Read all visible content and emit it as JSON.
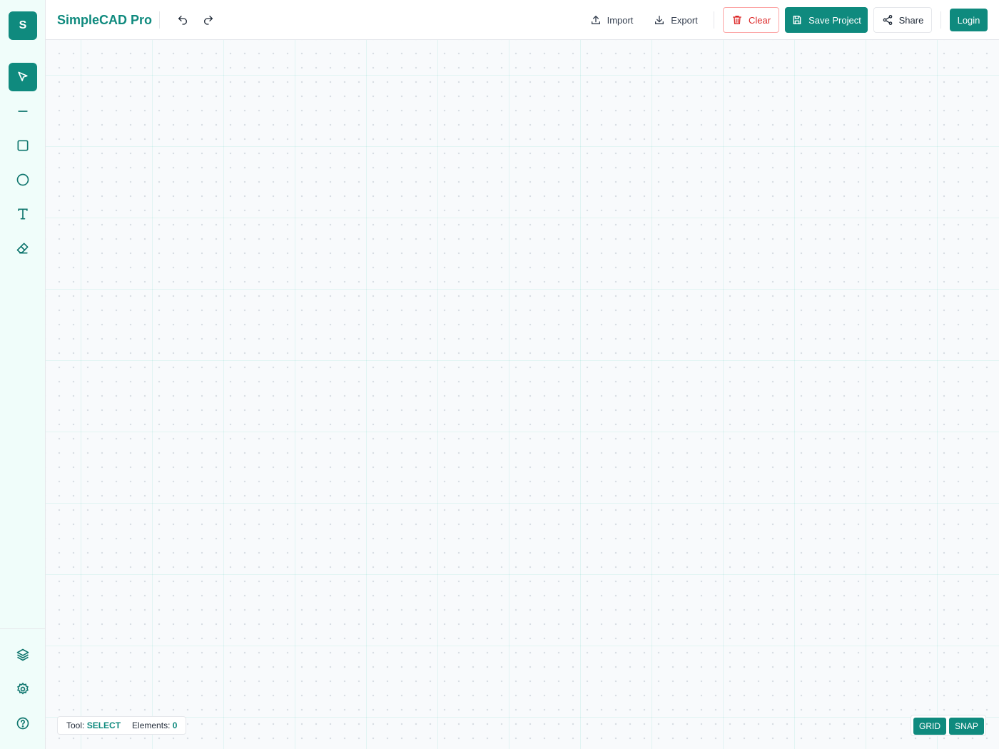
{
  "app": {
    "logo_letter": "S",
    "title": "SimpleCAD Pro",
    "accent_color": "#0f8a7e",
    "danger_color": "#dc2626"
  },
  "sidebar": {
    "tools": [
      {
        "id": "select",
        "icon": "pointer-icon",
        "active": true
      },
      {
        "id": "line",
        "icon": "line-icon",
        "active": false
      },
      {
        "id": "rectangle",
        "icon": "square-icon",
        "active": false
      },
      {
        "id": "circle",
        "icon": "circle-icon",
        "active": false
      },
      {
        "id": "text",
        "icon": "text-icon",
        "active": false
      },
      {
        "id": "eraser",
        "icon": "eraser-icon",
        "active": false
      }
    ],
    "bottom": [
      {
        "id": "layers",
        "icon": "layers-icon"
      },
      {
        "id": "settings",
        "icon": "gear-icon"
      },
      {
        "id": "help",
        "icon": "help-circle-icon"
      }
    ]
  },
  "header": {
    "undo_icon": "undo-icon",
    "redo_icon": "redo-icon",
    "import_label": "Import",
    "export_label": "Export",
    "clear_label": "Clear",
    "save_label": "Save Project",
    "share_label": "Share",
    "login_label": "Login"
  },
  "status": {
    "tool_label": "Tool:",
    "tool_value": "SELECT",
    "elements_label": "Elements:",
    "elements_value": "0"
  },
  "toggles": {
    "grid_label": "GRID",
    "snap_label": "SNAP",
    "grid_on": true,
    "snap_on": true
  }
}
